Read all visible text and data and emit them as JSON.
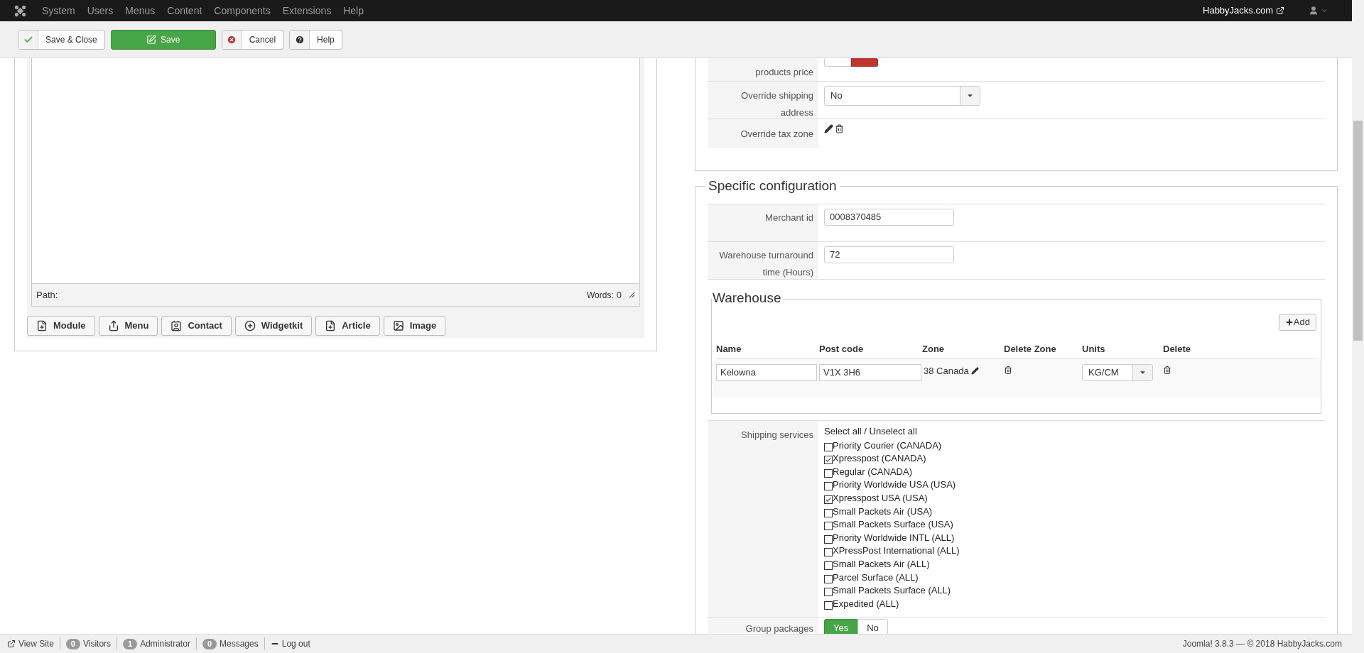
{
  "navbar": {
    "menu": [
      "System",
      "Users",
      "Menus",
      "Content",
      "Components",
      "Extensions",
      "Help"
    ],
    "site_link": "HabbyJacks.com"
  },
  "toolbar": {
    "buttons": [
      {
        "kind": "save_close",
        "label": "Save & Close"
      },
      {
        "kind": "save",
        "label": "Save"
      },
      {
        "kind": "cancel",
        "label": "Cancel"
      },
      {
        "kind": "help",
        "label": "Help"
      }
    ]
  },
  "editor": {
    "path_label": "Path:",
    "words_label": "Words:",
    "words_count": "0",
    "insert_buttons": [
      {
        "kind": "module",
        "label": "Module"
      },
      {
        "kind": "menu",
        "label": "Menu"
      },
      {
        "kind": "contact",
        "label": "Contact"
      },
      {
        "kind": "widgetkit",
        "label": "Widgetkit"
      },
      {
        "kind": "article",
        "label": "Article"
      },
      {
        "kind": "image",
        "label": "Image"
      }
    ]
  },
  "general_config": {
    "rows": [
      {
        "kind": "toggle",
        "label": "products price",
        "options": [
          {
            "kind": "yes",
            "selected": false
          },
          {
            "kind": "no",
            "selected": true
          }
        ]
      },
      {
        "kind": "select",
        "label": "Override shipping address",
        "value": "No"
      },
      {
        "kind": "icons",
        "label": "Override tax zone"
      }
    ]
  },
  "specific_config": {
    "title": "Specific configuration",
    "fields": [
      {
        "label": "Merchant id",
        "value": "0008370485"
      },
      {
        "label": "Warehouse turnaround time (Hours)",
        "value": "72"
      }
    ],
    "warehouse": {
      "title": "Warehouse",
      "add_button": "Add",
      "columns": [
        "Name",
        "Post code",
        "Zone",
        "Delete Zone",
        "Units",
        "Delete"
      ],
      "rows": [
        {
          "name": "Kelowna",
          "post_code": "V1X 3H6",
          "zone": "38 Canada",
          "units": "KG/CM"
        }
      ]
    },
    "shipping_services": {
      "label": "Shipping services",
      "select_all": "Select all / Unselect all",
      "options": [
        {
          "label": "Priority Courier (CANADA)",
          "checked": false
        },
        {
          "label": "Xpresspost (CANADA)",
          "checked": true
        },
        {
          "label": "Regular (CANADA)",
          "checked": false
        },
        {
          "label": "Priority Worldwide USA (USA)",
          "checked": false
        },
        {
          "label": "Xpresspost USA (USA)",
          "checked": true
        },
        {
          "label": "Small Packets Air (USA)",
          "checked": false
        },
        {
          "label": "Small Packets Surface (USA)",
          "checked": false
        },
        {
          "label": "Priority Worldwide INTL (ALL)",
          "checked": false
        },
        {
          "label": "XPressPost International (ALL)",
          "checked": false
        },
        {
          "label": "Small Packets Air (ALL)",
          "checked": false
        },
        {
          "label": "Parcel Surface (ALL)",
          "checked": false
        },
        {
          "label": "Small Packets Surface (ALL)",
          "checked": false
        },
        {
          "label": "Expedited (ALL)",
          "checked": false
        }
      ]
    },
    "group_packages": {
      "label": "Group packages",
      "options": [
        {
          "kind": "yes",
          "label": "Yes",
          "selected": true
        },
        {
          "kind": "no",
          "label": "No",
          "selected": false
        }
      ]
    }
  },
  "status_bar": {
    "items": [
      {
        "kind": "link",
        "label": "View Site"
      },
      {
        "kind": "count",
        "count": "0",
        "label": "Visitors"
      },
      {
        "kind": "count",
        "count": "1",
        "label": "Administrator"
      },
      {
        "kind": "count",
        "count": "0",
        "label": "Messages"
      },
      {
        "kind": "logout",
        "label": "Log out"
      }
    ],
    "version": "Joomla! 3.8.3 — © 2018 HabbyJacks.com"
  }
}
